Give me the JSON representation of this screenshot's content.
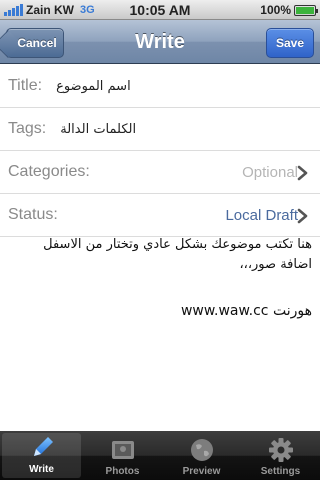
{
  "status_bar": {
    "carrier": "Zain KW",
    "network": "3G",
    "time": "10:05 AM",
    "battery": "100%"
  },
  "nav": {
    "title": "Write",
    "cancel_label": "Cancel",
    "save_label": "Save"
  },
  "form": {
    "title_label": "Title:",
    "title_value": "اسم الموضوع",
    "tags_label": "Tags:",
    "tags_value": "الكلمات الدالة",
    "categories_label": "Categories:",
    "categories_value": "Optional",
    "status_label": "Status:",
    "status_value": "Local Draft"
  },
  "body": {
    "paragraph": "هنا تكتب موضوعك بشكل عادي وتختار من الاسفل اضافة صور،،،",
    "link_line": "www.waw.cc هورنت"
  },
  "tabs": [
    {
      "label": "Write",
      "icon": "pencil-icon"
    },
    {
      "label": "Photos",
      "icon": "photos-icon"
    },
    {
      "label": "Preview",
      "icon": "globe-icon"
    },
    {
      "label": "Settings",
      "icon": "gear-icon"
    }
  ],
  "colors": {
    "nav_bar": "#7c91af",
    "save_button": "#2f63c9",
    "status_value": "#4a6a9e",
    "tab_bar": "#141414"
  }
}
